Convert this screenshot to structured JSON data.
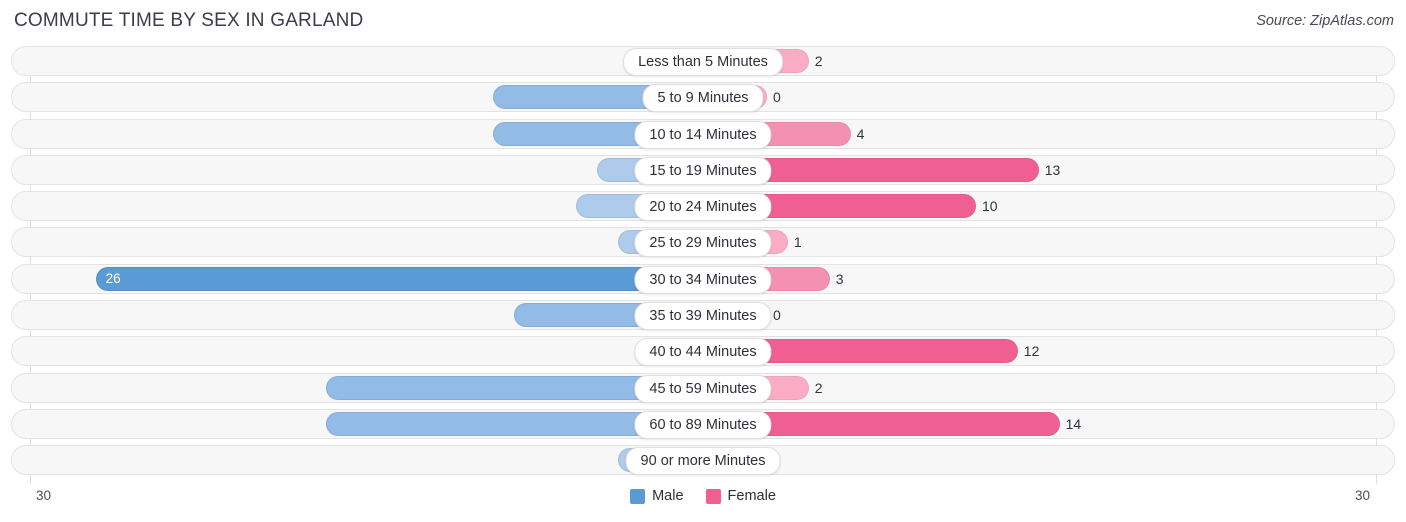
{
  "header": {
    "title": "COMMUTE TIME BY SEX IN GARLAND",
    "source": "Source: ZipAtlas.com"
  },
  "axis": {
    "left_label": "30",
    "right_label": "30"
  },
  "legend": {
    "items": [
      {
        "label": "Male",
        "color": "#5b9bd5"
      },
      {
        "label": "Female",
        "color": "#ef5f92"
      }
    ]
  },
  "colors": {
    "male_light": "#aecbeb",
    "male_mid": "#92bbe5",
    "male_dark": "#5b9bd5",
    "female_light": "#f9acc4",
    "female_mid": "#f490b2",
    "female_dark": "#ef5f92",
    "track_bg": "#f7f7f7",
    "track_border": "#e3e3e3",
    "gridline": "#dedede",
    "title": "#3c3c4a"
  },
  "chart_data": {
    "type": "bar",
    "title": "COMMUTE TIME BY SEX IN GARLAND",
    "subtitle": "",
    "xlabel": "",
    "ylabel": "",
    "orientation": "horizontal-diverging",
    "axis_max": 30,
    "xlim": [
      30,
      30
    ],
    "grid": true,
    "legend_position": "bottom-center",
    "categories": [
      "Less than 5 Minutes",
      "5 to 9 Minutes",
      "10 to 14 Minutes",
      "15 to 19 Minutes",
      "20 to 24 Minutes",
      "25 to 29 Minutes",
      "30 to 34 Minutes",
      "35 to 39 Minutes",
      "40 to 44 Minutes",
      "45 to 59 Minutes",
      "60 to 89 Minutes",
      "90 or more Minutes"
    ],
    "series": [
      {
        "name": "Male",
        "side": "left",
        "values": [
          0,
          7,
          7,
          2,
          3,
          1,
          26,
          6,
          0,
          15,
          15,
          1
        ]
      },
      {
        "name": "Female",
        "side": "right",
        "values": [
          2,
          0,
          4,
          13,
          10,
          1,
          3,
          0,
          12,
          2,
          14,
          0
        ]
      }
    ]
  },
  "rows": [
    {
      "label": "Less than 5 Minutes",
      "male": "0",
      "female": "2"
    },
    {
      "label": "5 to 9 Minutes",
      "male": "7",
      "female": "0"
    },
    {
      "label": "10 to 14 Minutes",
      "male": "7",
      "female": "4"
    },
    {
      "label": "15 to 19 Minutes",
      "male": "2",
      "female": "13"
    },
    {
      "label": "20 to 24 Minutes",
      "male": "3",
      "female": "10"
    },
    {
      "label": "25 to 29 Minutes",
      "male": "1",
      "female": "1"
    },
    {
      "label": "30 to 34 Minutes",
      "male": "26",
      "female": "3"
    },
    {
      "label": "35 to 39 Minutes",
      "male": "6",
      "female": "0"
    },
    {
      "label": "40 to 44 Minutes",
      "male": "0",
      "female": "12"
    },
    {
      "label": "45 to 59 Minutes",
      "male": "15",
      "female": "2"
    },
    {
      "label": "60 to 89 Minutes",
      "male": "15",
      "female": "14"
    },
    {
      "label": "90 or more Minutes",
      "male": "1",
      "female": "0"
    }
  ]
}
